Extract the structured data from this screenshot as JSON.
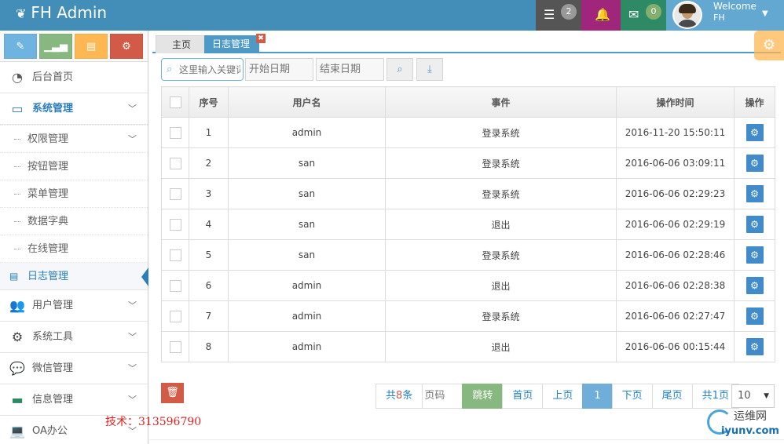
{
  "navbar": {
    "brand": "FH Admin",
    "tasks_count": "2",
    "messages_count": "0",
    "welcome": "Welcome",
    "user_name": "FH"
  },
  "sidebar": {
    "menu": [
      {
        "label": "后台首页",
        "icon": "dashboard-icon"
      },
      {
        "label": "系统管理",
        "icon": "desktop-icon"
      },
      {
        "label": "用户管理",
        "icon": "users-icon"
      },
      {
        "label": "系统工具",
        "icon": "cog-icon"
      },
      {
        "label": "微信管理",
        "icon": "comments-icon"
      },
      {
        "label": "信息管理",
        "icon": "credit-card-icon"
      },
      {
        "label": "OA办公",
        "icon": "laptop-icon"
      }
    ],
    "submenu": [
      {
        "label": "权限管理"
      },
      {
        "label": "按钮管理"
      },
      {
        "label": "菜单管理"
      },
      {
        "label": "数据字典"
      },
      {
        "label": "在线管理"
      },
      {
        "label": "日志管理"
      }
    ]
  },
  "tabs": {
    "home": "主页",
    "log": "日志管理"
  },
  "search": {
    "placeholder": "这里输入关键词",
    "start_placeholder": "开始日期",
    "end_placeholder": "结束日期"
  },
  "table": {
    "headers": [
      "序号",
      "用户名",
      "事件",
      "操作时间",
      "操作"
    ],
    "rows": [
      {
        "no": "1",
        "user": "admin",
        "event": "登录系统",
        "time": "2016-11-20 15:50:11"
      },
      {
        "no": "2",
        "user": "san",
        "event": "登录系统",
        "time": "2016-06-06 03:09:11"
      },
      {
        "no": "3",
        "user": "san",
        "event": "登录系统",
        "time": "2016-06-06 02:29:23"
      },
      {
        "no": "4",
        "user": "san",
        "event": "退出",
        "time": "2016-06-06 02:29:19"
      },
      {
        "no": "5",
        "user": "san",
        "event": "登录系统",
        "time": "2016-06-06 02:28:46"
      },
      {
        "no": "6",
        "user": "admin",
        "event": "退出",
        "time": "2016-06-06 02:28:38"
      },
      {
        "no": "7",
        "user": "admin",
        "event": "登录系统",
        "time": "2016-06-06 02:27:47"
      },
      {
        "no": "8",
        "user": "admin",
        "event": "退出",
        "time": "2016-06-06 00:15:44"
      }
    ]
  },
  "pager": {
    "total_prefix": "共",
    "total_count": "8",
    "total_suffix": "条",
    "page_placeholder": "页码",
    "jump": "跳转",
    "first": "首页",
    "prev": "上页",
    "current": "1",
    "next": "下页",
    "last": "尾页",
    "pages": "共1页",
    "page_size": "10"
  },
  "tech_note": "技术：313596790",
  "watermark": {
    "line1": "运维网",
    "line2": "iyunv.com"
  }
}
